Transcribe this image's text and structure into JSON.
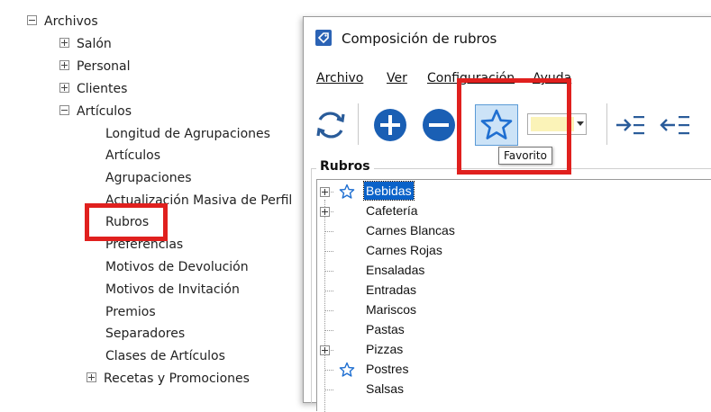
{
  "tree": {
    "root": {
      "label": "Archivos",
      "state": "expanded"
    },
    "children": [
      {
        "label": "Salón",
        "state": "collapsed"
      },
      {
        "label": "Personal",
        "state": "collapsed"
      },
      {
        "label": "Clientes",
        "state": "collapsed"
      },
      {
        "label": "Artículos",
        "state": "expanded"
      }
    ],
    "articulos_items": [
      "Longitud de Agrupaciones",
      "Artículos",
      "Agrupaciones",
      "Actualización Masiva de Perfil",
      "Rubros",
      "Preferencias",
      "Motivos de Devolución",
      "Motivos de Invitación",
      "Premios",
      "Separadores",
      "Clases de Artículos"
    ],
    "last": {
      "label": "Recetas y Promociones",
      "state": "collapsed"
    }
  },
  "dialog": {
    "title": "Composición de rubros",
    "menu": [
      "Archivo",
      "Ver",
      "Configuración",
      "Ayuda"
    ],
    "toolbar": {
      "refresh_icon": "refresh-icon",
      "add_icon": "plus-circle-icon",
      "remove_icon": "minus-circle-icon",
      "favorite_icon": "star-icon",
      "favorite_tooltip": "Favorito",
      "color_swatch": "#fbf3b8",
      "indent_icon": "indent-icon",
      "outdent_icon": "outdent-icon"
    },
    "group_label": "Rubros",
    "rubros": [
      {
        "label": "Bebidas",
        "expandable": true,
        "favorite": true,
        "selected": true
      },
      {
        "label": "Cafetería",
        "expandable": true,
        "favorite": false,
        "selected": false
      },
      {
        "label": "Carnes Blancas",
        "expandable": false,
        "favorite": false,
        "selected": false
      },
      {
        "label": "Carnes Rojas",
        "expandable": false,
        "favorite": false,
        "selected": false
      },
      {
        "label": "Ensaladas",
        "expandable": false,
        "favorite": false,
        "selected": false
      },
      {
        "label": "Entradas",
        "expandable": false,
        "favorite": false,
        "selected": false
      },
      {
        "label": "Mariscos",
        "expandable": false,
        "favorite": false,
        "selected": false
      },
      {
        "label": "Pastas",
        "expandable": false,
        "favorite": false,
        "selected": false
      },
      {
        "label": "Pizzas",
        "expandable": true,
        "favorite": false,
        "selected": false
      },
      {
        "label": "Postres",
        "expandable": false,
        "favorite": true,
        "selected": false
      },
      {
        "label": "Salsas",
        "expandable": false,
        "favorite": false,
        "selected": false
      }
    ]
  },
  "colors": {
    "highlight_red": "#e0201e",
    "selection_blue": "#0a62c9",
    "icon_blue": "#1a5fb4",
    "star_outline": "#1f6fd1"
  }
}
